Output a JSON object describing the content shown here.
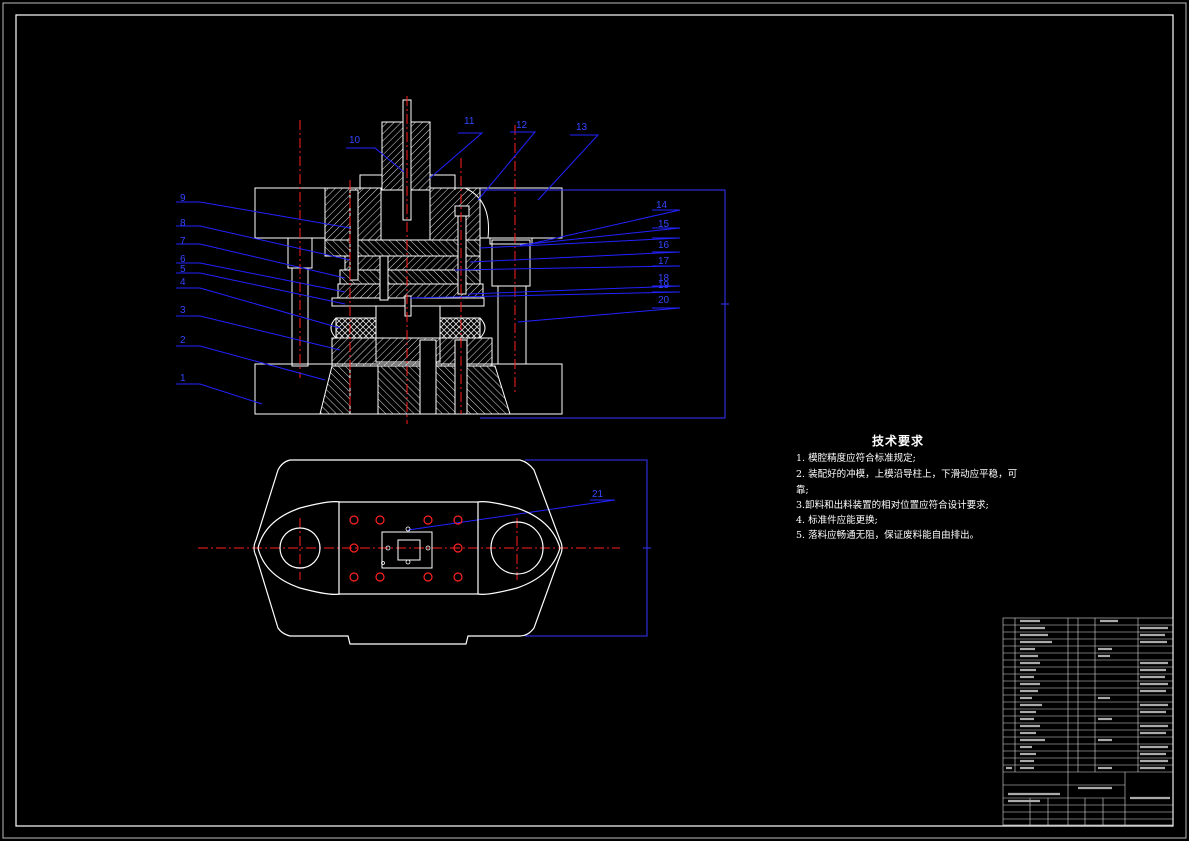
{
  "colors": {
    "background": "#000000",
    "outline": "#ffffff",
    "leader": "#2222ff",
    "centerline": "#ff2020",
    "dimension": "#3333ff",
    "hatch": "#e8e8e8"
  },
  "part_labels": [
    "1",
    "2",
    "3",
    "4",
    "5",
    "6",
    "7",
    "8",
    "9",
    "10",
    "11",
    "12",
    "13",
    "14",
    "15",
    "16",
    "17",
    "18",
    "19",
    "20",
    "21"
  ],
  "technical_requirements": {
    "title": "技术要求",
    "items": [
      "1. 模腔精度应符合标准规定;",
      "2. 装配好的冲模，上模沿导柱上，下滑动应平稳，可",
      "靠;",
      "3.卸料和出料装置的相对位置应符合设计要求;",
      "4. 标准件应能更换;",
      "5. 落料应畅通无阻，保证废料能自由排出。"
    ]
  }
}
